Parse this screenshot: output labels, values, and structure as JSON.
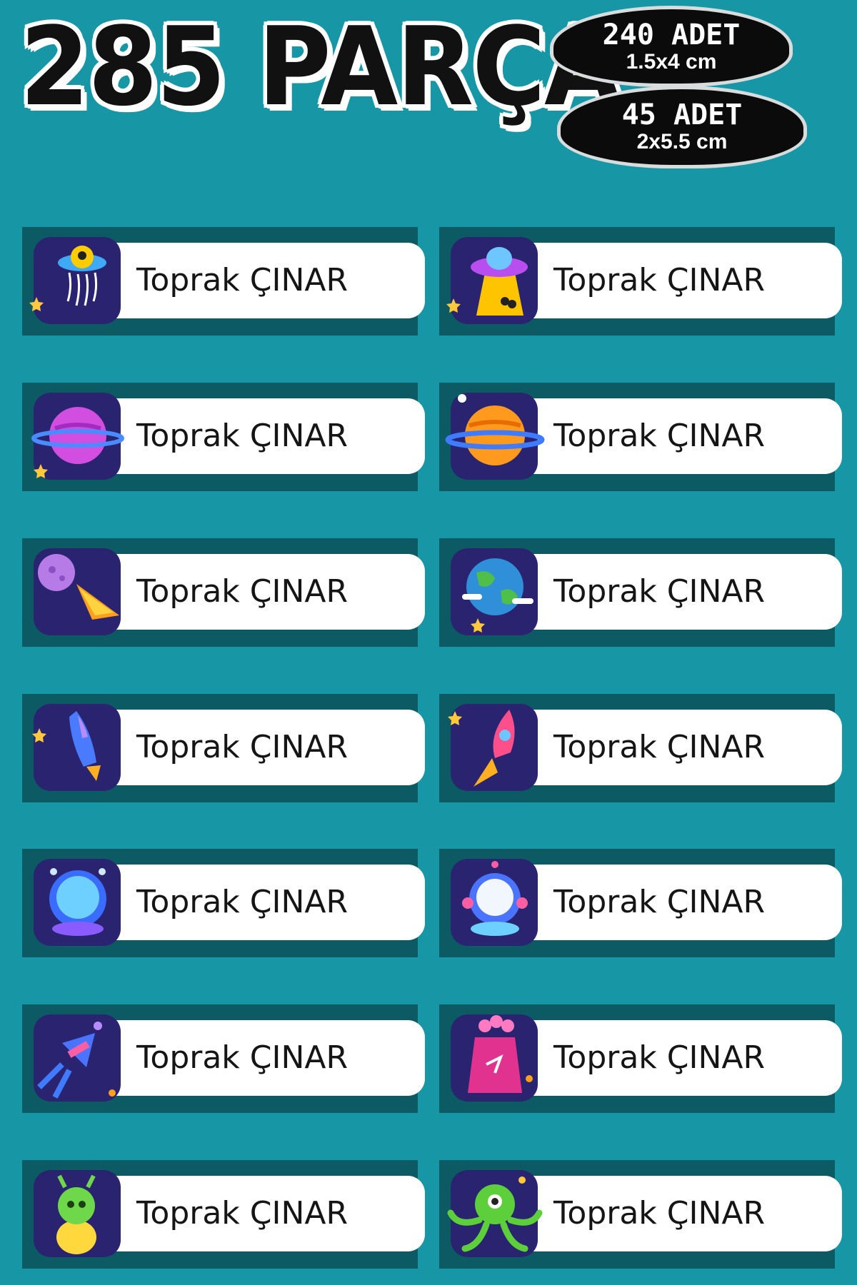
{
  "header": {
    "title": "285 PARÇA",
    "badges": [
      {
        "qty": "240 ADET",
        "size": "1.5x4 cm"
      },
      {
        "qty": "45 ADET",
        "size": "2x5.5 cm"
      }
    ]
  },
  "labels": [
    {
      "name": "Toprak ÇINAR",
      "icon": "ufo-jellyfish-icon"
    },
    {
      "name": "Toprak ÇINAR",
      "icon": "ufo-beam-icon"
    },
    {
      "name": "Toprak ÇINAR",
      "icon": "pink-planet-icon"
    },
    {
      "name": "Toprak ÇINAR",
      "icon": "orange-planet-icon"
    },
    {
      "name": "Toprak ÇINAR",
      "icon": "meteor-icon"
    },
    {
      "name": "Toprak ÇINAR",
      "icon": "earth-icon"
    },
    {
      "name": "Toprak ÇINAR",
      "icon": "blue-rocket-icon"
    },
    {
      "name": "Toprak ÇINAR",
      "icon": "red-rocket-icon"
    },
    {
      "name": "Toprak ÇINAR",
      "icon": "astronaut-helmet-icon"
    },
    {
      "name": "Toprak ÇINAR",
      "icon": "alien-helmet-icon"
    },
    {
      "name": "Toprak ÇINAR",
      "icon": "satellite-icon"
    },
    {
      "name": "Toprak ÇINAR",
      "icon": "pink-monster-icon"
    },
    {
      "name": "Toprak ÇINAR",
      "icon": "green-alien-icon"
    },
    {
      "name": "Toprak ÇINAR",
      "icon": "green-octopus-alien-icon"
    }
  ],
  "colors": {
    "background": "#1796a6",
    "card": "#0c5a64",
    "icon_bg": "#2a2470"
  }
}
